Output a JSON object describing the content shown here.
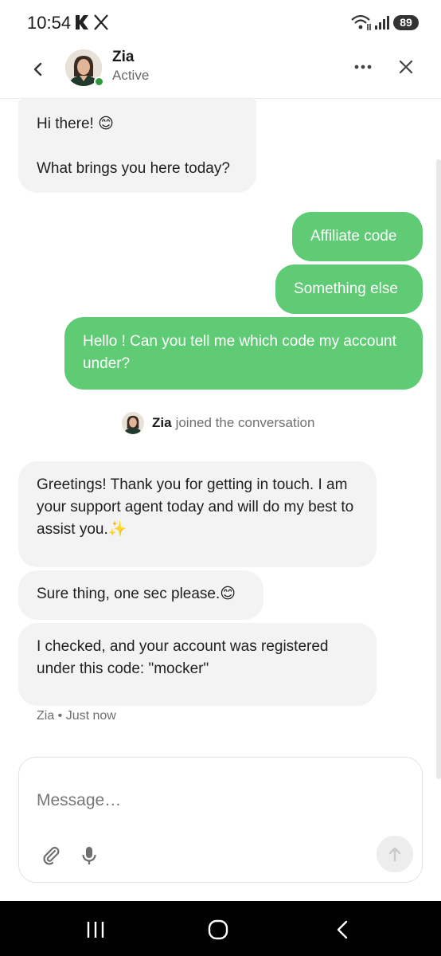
{
  "status_bar": {
    "time": "10:54",
    "battery": "89",
    "icons": [
      "k-icon",
      "x-logo-icon",
      "wifi-icon",
      "signal-icon",
      "battery-icon"
    ]
  },
  "header": {
    "agent_name": "Zia",
    "agent_status": "Active",
    "icons": [
      "back-chevron-icon",
      "avatar",
      "more-dots-icon",
      "close-icon"
    ],
    "online_color": "#2e9b3b"
  },
  "messages": {
    "hi_line1": "Hi there! 😊",
    "hi_line2": "What brings you here today?",
    "option_affiliate": "Affiliate code",
    "option_something": "Something else",
    "user_question": "Hello ! Can you tell me which code my account under?",
    "join_name": "Zia",
    "join_text": "joined the conversation",
    "greeting": "Greetings! Thank you for getting in touch. I am your support agent today and will do my best to assist you.✨",
    "sure": "Sure thing, one sec please.😊",
    "checked": "I checked, and your account was registered under this code: \"mocker\"",
    "meta": "Zia • Just now"
  },
  "composer": {
    "placeholder": "Message…",
    "icons": [
      "paperclip-icon",
      "microphone-icon",
      "send-arrow-icon"
    ]
  },
  "colors": {
    "outgoing_bubble": "#5fcb74",
    "incoming_bubble": "#f3f3f3",
    "nav_bar": "#000000"
  },
  "nav": {
    "icons": [
      "recents-icon",
      "home-icon",
      "back-icon"
    ]
  }
}
